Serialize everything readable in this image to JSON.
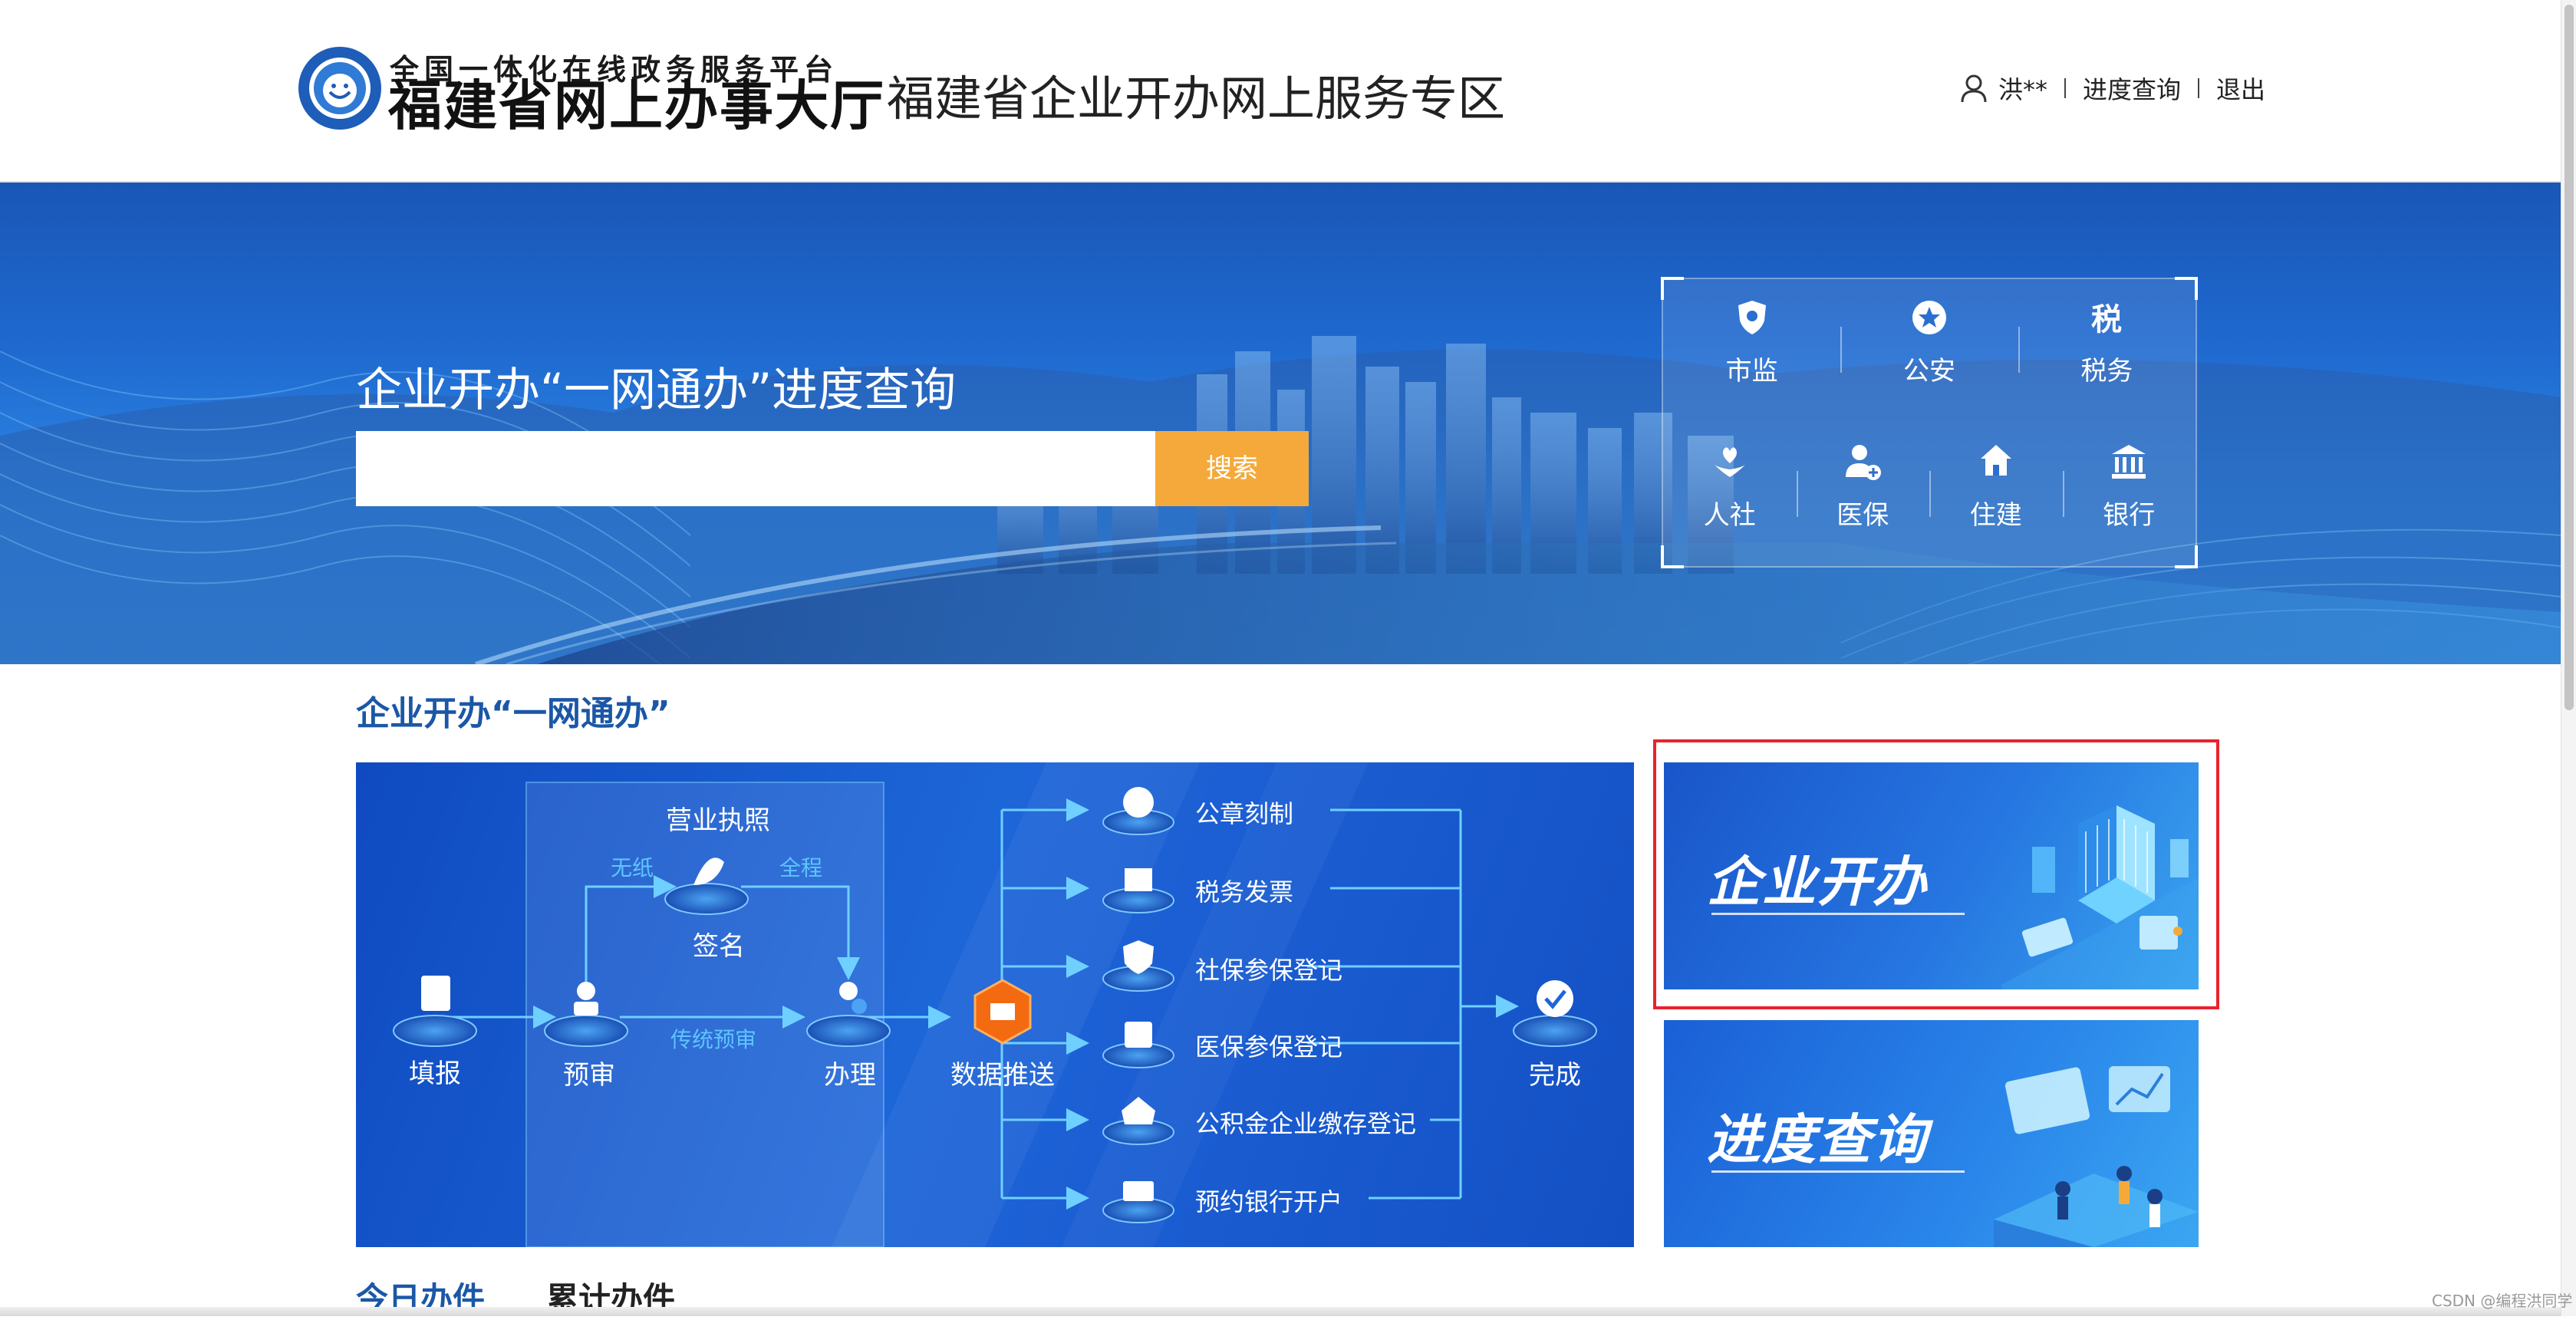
{
  "header": {
    "logo_top": "全国一体化在线政务服务平台",
    "logo_main": "福建省网上办事大厅",
    "site_title": "福建省企业开办网上服务专区",
    "user_name": "洪**",
    "progress_link": "进度查询",
    "logout_link": "退出"
  },
  "banner": {
    "search_title": "企业开办“一网通办”进度查询",
    "search_placeholder": "",
    "search_button": "搜索",
    "departments": [
      {
        "label": "市监",
        "icon": "police-badge-icon"
      },
      {
        "label": "公安",
        "icon": "shield-star-icon"
      },
      {
        "label": "税务",
        "icon": "tax-icon"
      },
      {
        "label": "人社",
        "icon": "hands-heart-icon"
      },
      {
        "label": "医保",
        "icon": "person-plus-icon"
      },
      {
        "label": "住建",
        "icon": "house-icon"
      },
      {
        "label": "银行",
        "icon": "bank-icon"
      }
    ]
  },
  "section": {
    "title": "企业开办“一网通办”",
    "flow": {
      "license_group": "营业执照",
      "no_paper": "无纸",
      "full_process": "全程",
      "traditional_review": "传统预审",
      "steps": [
        "填报",
        "预审",
        "签名",
        "办理",
        "数据推送",
        "完成"
      ],
      "services": [
        "公章刻制",
        "税务发票",
        "社保参保登记",
        "医保参保登记",
        "公积金企业缴存登记",
        "预约银行开户"
      ]
    },
    "cards": {
      "open_business": "企业开办",
      "progress_query": "进度查询"
    }
  },
  "stats": {
    "tabs": [
      "今日办件",
      "累计办件"
    ]
  },
  "watermark": "CSDN @编程洪同学",
  "colors": {
    "primary": "#1b57a6",
    "banner_blue": "#1f6ad0",
    "search_button": "#f5a93a",
    "highlight": "#e8232e"
  }
}
